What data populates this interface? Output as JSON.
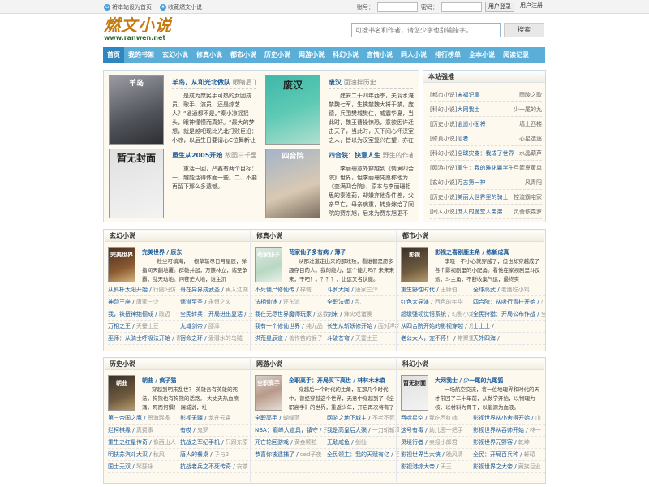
{
  "topbar": {
    "set_home": "将本站设为首页",
    "bookmark": "收藏燃文小说",
    "account_label": "账号：",
    "password_label": "密码：",
    "login": "用户登录",
    "register": "用户注册"
  },
  "logo": {
    "main": "燃文小说",
    "url": "www.ranwen.net"
  },
  "search": {
    "placeholder": "可搜书名和作者，请您少字也别输错字。",
    "button": "搜索"
  },
  "nav": {
    "items": [
      "首页",
      "我的书架",
      "玄幻小说",
      "修真小说",
      "都市小说",
      "历史小说",
      "网游小说",
      "科幻小说",
      "言情小说",
      "同人小说",
      "排行榜单",
      "全本小说",
      "阅读记录"
    ]
  },
  "featured": [
    {
      "title": "羊岛，从和光北做队",
      "author": "眼睛眉下",
      "cover_text": "羊岛",
      "desc": "是成为庶民手可热的女团成员、歌手、演员，还是综艺人？“通通都不是。”秦小凉摇摇头，眼神懂懂而真好。“最大的梦想，就是越吧现比光北打败巨沿：小凉，以后生日要请心C位舞新让给你！"
    },
    {
      "title": "废汉",
      "author": "面油拌历史",
      "cover_text": "废汉",
      "desc": "建安二十四年西季，关羽水淹禁魏七军，生擒禁魏大将于禁，庞德，兵围樊城樊仁，威震华夏，当此时，魏王曹操惊恐，意欲因许迁击天子，当此时，天下间心怀汉室之人，皆以为汉室复兴在望，亦在"
    },
    {
      "title": "重生从2005开始",
      "author": "故园三千里",
      "cover_text": "暂无封面",
      "desc": "重活一回，严鑫有两个目标：一、越能活得体面一些。二、不要再留下那么多遗憾。"
    },
    {
      "title": "四合院：快意人生",
      "author": "野生的作者",
      "cover_text": "四合院",
      "desc": "李丽珊意外穿越到《情满四合院》世界，但李丽珊凭愿称他为《查满四合院》，原本与李丽珊相思的秦淮茹，却嫌弃他条件差，父亲早亡，母亲病重，转身嫁给了同院的贾东旭，后来为贾东旭更不"
    }
  ],
  "sidebar": {
    "title": "本站强推",
    "rows": [
      {
        "cat": "[都市小说]",
        "book": "宋福记事",
        "author": "雨陵之歌"
      },
      {
        "cat": "[科幻小说]",
        "book": "大网我士",
        "author": "少一尾的九"
      },
      {
        "cat": "[历史小说]",
        "book": "逍遥小衙将",
        "author": "墙上西楼"
      },
      {
        "cat": "[修真小说]",
        "book": "仙者",
        "author": "心星选逐"
      },
      {
        "cat": "[科幻小说]",
        "book": "全球灾变：我成了世界",
        "author": "水晶葫芦"
      },
      {
        "cat": "[网游小说]",
        "book": "重生：我的雅化翼学生",
        "author": "弓箭夏黄单"
      },
      {
        "cat": "[玄幻小说]",
        "book": "万古第一神",
        "author": "风青阳"
      },
      {
        "cat": "[历史小说]",
        "book": "美丽大世界里的骑士",
        "author": "控流霸宅家"
      },
      {
        "cat": "[同人小说]",
        "book": "庶人的魔堂人弟弟",
        "author": "灵斋依森罗"
      }
    ]
  },
  "sections": [
    {
      "title": "玄幻小说",
      "book": "完美世界 / 辰东",
      "cover_text": "完美世界",
      "desc": "一粒尘可填海，一根草斩尽日月星辰，弹指间天翻地覆。群雄并起，万族林立，诸圣争霸，乱天动地。问苍茫大地，谁主沉",
      "list": [
        [
          "从斜杆太阳开始",
          "行圆冯仿"
        ],
        [
          "哥在异界成武圣",
          "再入江湖"
        ],
        [
          "神印王座",
          "唐家三少"
        ],
        [
          "儒道至圣",
          "永恒之火"
        ],
        [
          "我，铁扭神绝德成",
          "政迈"
        ],
        [
          "全民转兵：开局进出复活",
          "三水兵"
        ],
        [
          "万相之王",
          "天蚕土豆"
        ],
        [
          "九域剑帝",
          "邵泽"
        ],
        [
          "巫师：从骑士呼吸法开始",
          "青布衫"
        ],
        [
          "宿命之环",
          "爱潜水的乌贼"
        ]
      ]
    },
    {
      "title": "修真小说",
      "book": "苟家仙子多有病 / 薄子",
      "cover_text": "苟家仙子",
      "desc": "从那过道走出来的那戏殃，看谁都是愿多趣存目的人。我的能力，这个能力吗？未来来来，干吧！。？？？，比这又名伏魔。",
      "list": [
        [
          "不死僵尸修仙传",
          "梓城"
        ],
        [
          "斗罗大阿",
          "唐家三少"
        ],
        [
          "法相仙途",
          "还东流"
        ],
        [
          "全职法师",
          "乱"
        ],
        [
          "我在无尽世界魔师玩家",
          "这我叫好天"
        ],
        [
          "剑来",
          "烽火戏诸侯"
        ],
        [
          "我有一个修仙世界",
          "纯九品"
        ],
        [
          "长生从斩妖修开始",
          "面对洋新"
        ],
        [
          "洪荒星辰道",
          "善作苦的猴子"
        ],
        [
          "斗破苍穹",
          "天蚕土豆"
        ]
      ]
    },
    {
      "title": "都市小说",
      "book": "影视之喜剧鹿主角 / 练新成真",
      "cover_text": "影视",
      "desc": "李晓一不小心就穿越了，但也却穿越成了各个影视剧里的小配角。看他在家视剧里斗反派，斗主角，不断收集气运，最终实",
      "list": [
        [
          "重生野性时代",
          "王师伯"
        ],
        [
          "全球高武",
          "老鹰吃小鸡"
        ],
        [
          "红色大导演",
          "西色的年华"
        ],
        [
          "四合院：从吸行青柱开始",
          "小"
        ],
        [
          "超级强韧觉悟系统",
          "幻影小龙"
        ],
        [
          "全民狩猎：开局公布作战",
          "全"
        ],
        [
          "从四合院开始的影视穿越",
          "危机处理游戏"
        ],
        [
          "士土土",
          ""
        ],
        [
          "老公大人，宠不停！",
          "带聚重回1990"
        ],
        [
          "天外四海",
          ""
        ]
      ]
    },
    {
      "title": "历史小说",
      "book": "朝曲 / 疯子猫",
      "cover_text": "朝曲",
      "desc": "穿越到明末乱世？ 英雄吾有英雄的死法，狗熊也有狗熊的活路。 大丈夫热血喷涌，死而何惧！ 屠城说，址",
      "list": [
        [
          "第三帝国之鹰",
          "恩海瑶多"
        ],
        [
          "影视无疆",
          "龙升云霄"
        ],
        [
          "烂柯棋缘",
          "真费事"
        ],
        [
          "有哎",
          "鬼罗"
        ],
        [
          "重生之红星传奇",
          "像西山人"
        ],
        [
          "抗战之军纪手机",
          "只跟东原"
        ],
        [
          "明扶苏汽斗大汉",
          "秋风"
        ],
        [
          "唐人的餐桌",
          "孑与2"
        ],
        [
          "国士无双",
          "琴瑟咏"
        ],
        [
          "抗战老兵之不死传奇",
          "安茶"
        ]
      ]
    },
    {
      "title": "网游小说",
      "book": "全职高手：开局买下高世 / 林林木木森",
      "cover_text": "全职高手",
      "desc": "穿越后一个时代的主角，在那几个时代中，曾经穿越这个世界，无意中穿越到了《全职高手》的世界，重返少年，开启再次将有了",
      "list": [
        [
          "全职高手",
          "蝴蝶蓝"
        ],
        [
          "网游之地下城主",
          "不老不死"
        ],
        [
          "NBA：巅峰大道具，镇守",
          "开局一座修心院",
          "西门城"
        ],
        [
          "我是高皇后大殒",
          "一刀斩斩草"
        ],
        [
          "死亡轮回游戏",
          "黄金颗粒"
        ],
        [
          "无敌咸鱼",
          "剑仙"
        ],
        [
          "恭喜你被逮捕了",
          "ced子夜"
        ],
        [
          "全民领主：我的天赋有亿",
          "百战金孤战争",
          "悟生厚重"
        ]
      ]
    },
    {
      "title": "科幻小说",
      "book": "大网我士 / 少一尾的九尾狐",
      "cover_text": "暂无封面",
      "desc": "一场航空交流，将一位地理界和时代的天才带回了二十年前，从数学开始，以物理为核，以材料为骨干，以能源为血液。",
      "list": [
        [
          "吞噬星空",
          "我吃西红柿"
        ],
        [
          "影视世界从小舍得开始",
          "山"
        ],
        [
          "这号有毒",
          "幼儿园一把手"
        ],
        [
          "影视世界从吞帅开始",
          "林一"
        ],
        [
          "灵境行者",
          "卖报小郎君"
        ],
        [
          "影视世界元野客",
          "乾坤"
        ],
        [
          "影视世界当大侠",
          "晚风清"
        ],
        [
          "全民：开局百兵种",
          "轩辕"
        ],
        [
          "影视港综大帝",
          "天王"
        ],
        [
          "影视世界之大帝",
          "藏族巨业"
        ]
      ]
    }
  ]
}
